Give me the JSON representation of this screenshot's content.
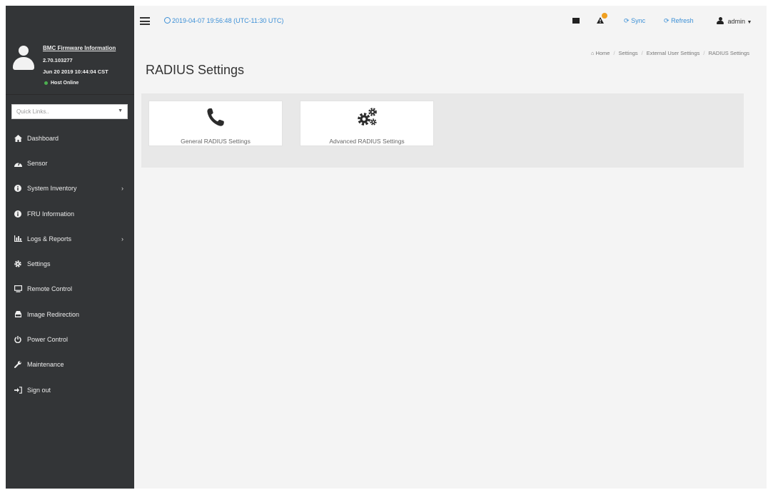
{
  "topbar": {
    "datetime": "2019-04-07 19:56:48 (UTC-11:30 UTC)",
    "sync_label": "Sync",
    "refresh_label": "Refresh",
    "user_label": "admin"
  },
  "sidebar": {
    "firmware_title": "BMC Firmware Information",
    "firmware_version": "2.70.103277",
    "firmware_date": "Jun 20 2019 10:44:04 CST",
    "host_status": "Host Online",
    "quick_links_placeholder": "Quick Links..",
    "items": [
      {
        "label": "Dashboard",
        "icon": "home-icon"
      },
      {
        "label": "Sensor",
        "icon": "sensor-icon"
      },
      {
        "label": "System Inventory",
        "icon": "info-icon",
        "has_children": true
      },
      {
        "label": "FRU Information",
        "icon": "info-icon"
      },
      {
        "label": "Logs & Reports",
        "icon": "chart-icon",
        "has_children": true
      },
      {
        "label": "Settings",
        "icon": "gear-icon"
      },
      {
        "label": "Remote Control",
        "icon": "monitor-icon"
      },
      {
        "label": "Image Redirection",
        "icon": "disc-icon"
      },
      {
        "label": "Power Control",
        "icon": "power-icon"
      },
      {
        "label": "Maintenance",
        "icon": "wrench-icon"
      },
      {
        "label": "Sign out",
        "icon": "sign-out-icon"
      }
    ]
  },
  "page": {
    "title": "RADIUS Settings",
    "breadcrumb": [
      "Home",
      "Settings",
      "External User Settings",
      "RADIUS Settings"
    ]
  },
  "cards": [
    {
      "label": "General RADIUS Settings",
      "icon": "phone-icon"
    },
    {
      "label": "Advanced RADIUS Settings",
      "icon": "gears-icon"
    }
  ],
  "colors": {
    "sidebar_bg": "#333537",
    "accent": "#3b8fd6",
    "alert_badge": "#f0a020",
    "host_online": "#4caf50"
  }
}
